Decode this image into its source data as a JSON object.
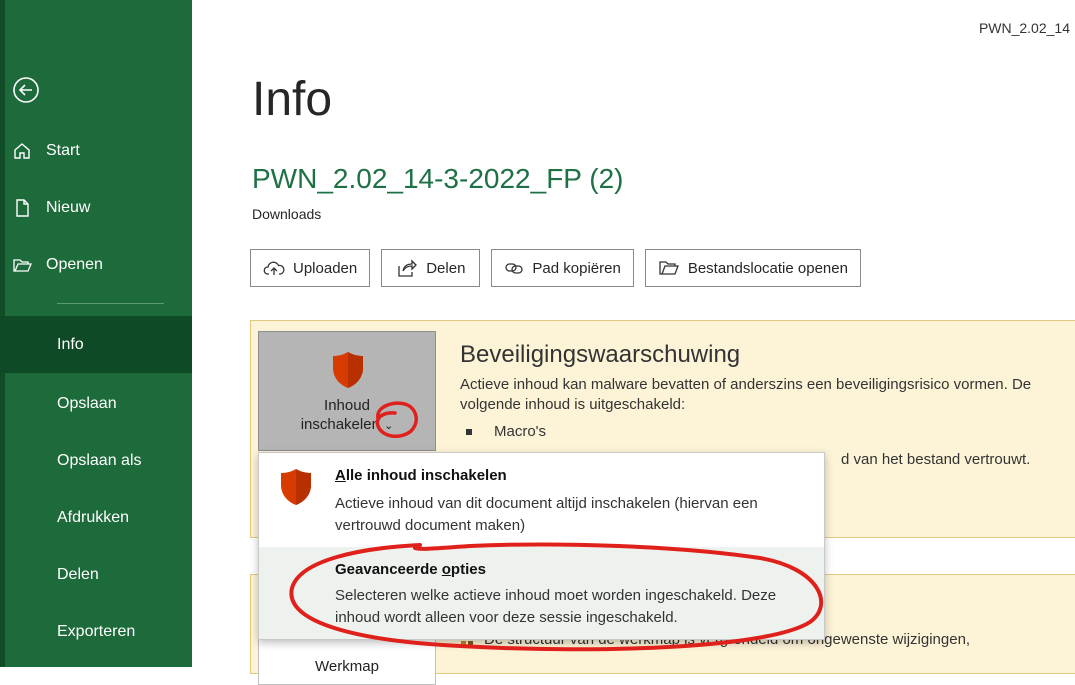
{
  "window": {
    "doc_title": "PWN_2.02_14"
  },
  "sidebar": {
    "back_icon": "back-arrow-icon",
    "items": [
      {
        "label": "Start",
        "icon": "home-icon"
      },
      {
        "label": "Nieuw",
        "icon": "new-document-icon"
      },
      {
        "label": "Openen",
        "icon": "folder-open-icon"
      },
      {
        "label": "Info",
        "active": true
      },
      {
        "label": "Opslaan"
      },
      {
        "label": "Opslaan als"
      },
      {
        "label": "Afdrukken"
      },
      {
        "label": "Delen"
      },
      {
        "label": "Exporteren"
      }
    ],
    "colors": {
      "background": "#1d6b3a",
      "active": "#0e4a25"
    }
  },
  "main": {
    "title": "Info",
    "document_name": "PWN_2.02_14-3-2022_FP (2)",
    "location": "Downloads",
    "actions": [
      {
        "label": "Uploaden",
        "icon": "cloud-upload-icon"
      },
      {
        "label": "Delen",
        "icon": "share-icon"
      },
      {
        "label": "Pad kopiëren",
        "icon": "link-icon"
      },
      {
        "label": "Bestandslocatie openen",
        "icon": "folder-open-icon"
      }
    ]
  },
  "security_warning": {
    "button_label_line1": "Inhoud",
    "button_label_line2": "inschakelen",
    "title": "Beveiligingswaarschuwing",
    "text": "Actieve inhoud kan malware bevatten of anderszins een beveiligingsrisico vormen. De volgende inhoud is uitgeschakeld:",
    "bullet": "Macro's",
    "tail_text": "d van het bestand vertrouwt.",
    "colors": {
      "panel": "#fdf4d8",
      "shield": "#d83b01"
    }
  },
  "protect_panel": {
    "tile_label": "Werkmap",
    "text": "De structuur van de werkmap is vergrendeld om ongewenste wijzigingen,"
  },
  "dropdown": {
    "items": [
      {
        "title_accel": "A",
        "title_rest": "lle inhoud inschakelen",
        "description": "Actieve inhoud van dit document altijd inschakelen (hiervan een vertrouwd document maken)"
      },
      {
        "title_before": "Geavanceerde ",
        "title_accel": "o",
        "title_after": "pties",
        "description": "Selecteren welke actieve inhoud moet worden ingeschakeld. Deze inhoud wordt alleen voor deze sessie ingeschakeld."
      }
    ]
  },
  "annotation_color": "#e0201b"
}
